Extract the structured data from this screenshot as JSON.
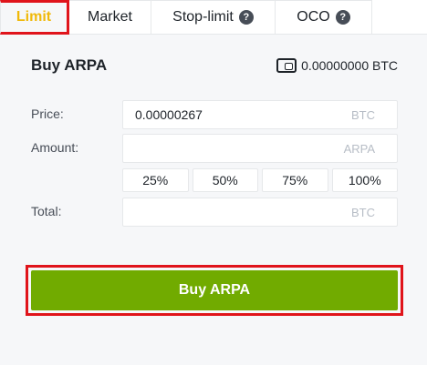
{
  "tabs": [
    {
      "label": "Limit"
    },
    {
      "label": "Market"
    },
    {
      "label": "Stop-limit"
    },
    {
      "label": "OCO"
    }
  ],
  "form": {
    "title": "Buy ARPA",
    "balance": "0.00000000 BTC",
    "price_label": "Price:",
    "price_value": "0.00000267",
    "price_unit": "BTC",
    "amount_label": "Amount:",
    "amount_value": "",
    "amount_unit": "ARPA",
    "percentages": [
      "25%",
      "50%",
      "75%",
      "100%"
    ],
    "total_label": "Total:",
    "total_value": "",
    "total_unit": "BTC",
    "submit_label": "Buy ARPA"
  },
  "colors": {
    "accent": "#f0b90b",
    "buy": "#71ab00",
    "highlight": "#e0141b"
  },
  "icons": {
    "help": "question-circle-icon",
    "wallet": "wallet-icon"
  }
}
